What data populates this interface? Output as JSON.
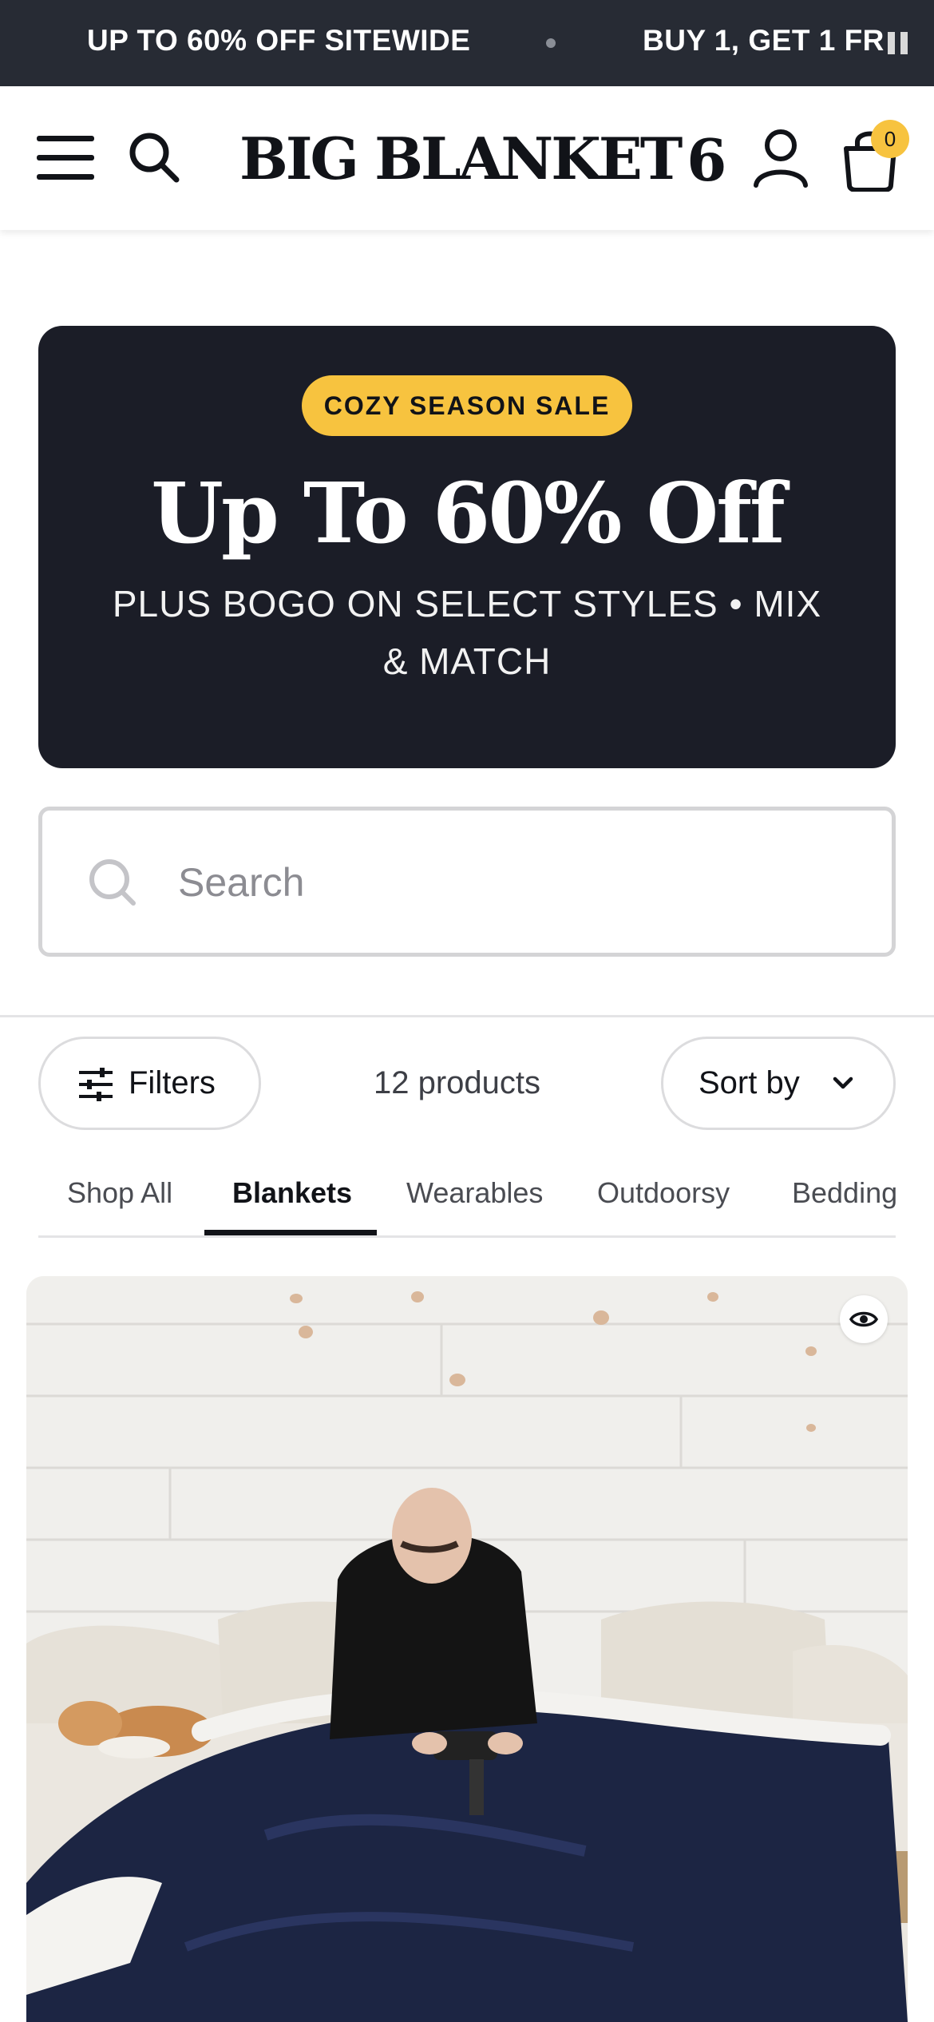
{
  "announcement": {
    "messages": [
      "UP TO 60% OFF SITEWIDE",
      "BUY 1, GET 1 FR"
    ],
    "pause_icon": "pause-icon"
  },
  "header": {
    "logo_text": "BIG BLANKET",
    "logo_mark": "6",
    "cart_count": "0",
    "icons": [
      "hamburger-menu-icon",
      "search-icon",
      "account-icon",
      "cart-bag-icon"
    ]
  },
  "promo": {
    "badge": "COZY SEASON SALE",
    "title": "Up To 60% Off",
    "subtitle": "PLUS BOGO ON SELECT STYLES • MIX & MATCH"
  },
  "search": {
    "placeholder": "Search",
    "value": ""
  },
  "toolbar": {
    "filters_label": "Filters",
    "product_count": "12 products",
    "sort_label": "Sort by"
  },
  "tabs": [
    {
      "label": "Shop All",
      "active": false
    },
    {
      "label": "Blankets",
      "active": true
    },
    {
      "label": "Wearables",
      "active": false
    },
    {
      "label": "Outdoorsy",
      "active": false
    },
    {
      "label": "Bedding",
      "active": false
    }
  ],
  "product": {
    "image_description_icon": "quick-view-eye-icon"
  },
  "colors": {
    "announcement_bg": "#272b34",
    "promo_bg": "#1b1d27",
    "accent_yellow": "#f7c33f",
    "text_dark": "#111318"
  }
}
